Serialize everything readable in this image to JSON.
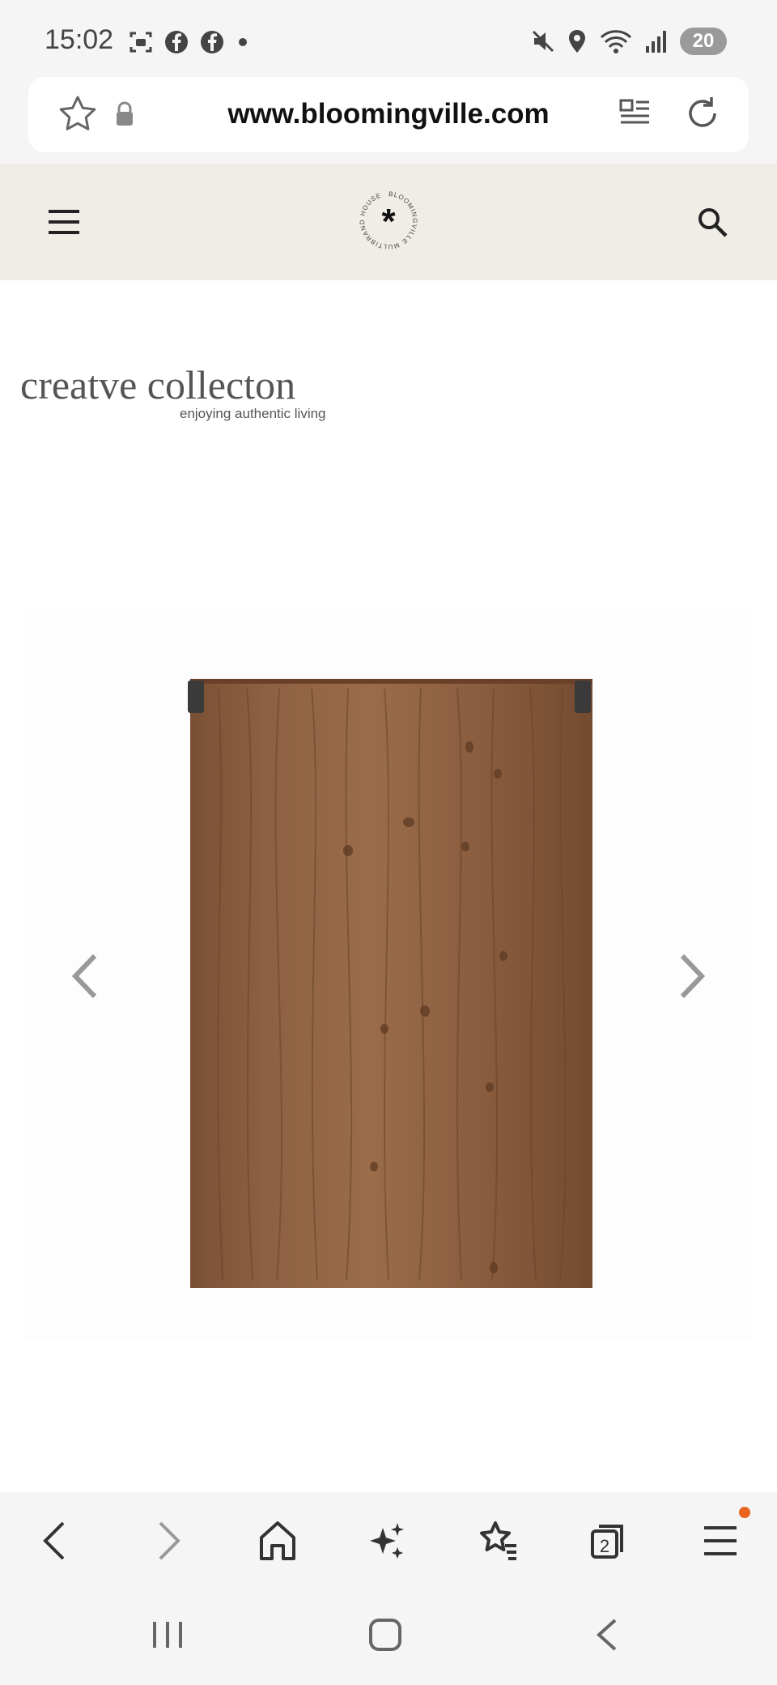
{
  "status_bar": {
    "time": "15:02",
    "battery": "20",
    "icons_left": [
      "screenshot-icon",
      "facebook-icon",
      "facebook-icon",
      "dot-icon"
    ],
    "icons_right": [
      "mute-icon",
      "location-icon",
      "wifi-icon",
      "signal-icon",
      "battery-icon"
    ]
  },
  "browser": {
    "url": "www.bloomingville.com",
    "icons": [
      "star-icon",
      "lock-icon",
      "reader-icon",
      "reload-icon"
    ]
  },
  "site_header": {
    "logo_ring_text": "BLOOMINGVILLE MULTIBRAND HOUSE",
    "logo_symbol": "*",
    "icons": [
      "menu-icon",
      "search-icon"
    ]
  },
  "brand": {
    "title": "creatve collecton",
    "tagline": "enjoying authentic living"
  },
  "carousel": {
    "product_image": "wooden-board-back",
    "prev_icon": "chevron-left-icon",
    "next_icon": "chevron-right-icon"
  },
  "bottom_toolbar": {
    "tabs_count": "2",
    "items": [
      "back-icon",
      "forward-icon",
      "home-icon",
      "sparkle-icon",
      "bookmarks-icon",
      "tabs-icon",
      "menu-icon"
    ],
    "accent_color": "#e8641f"
  },
  "system_nav": {
    "items": [
      "recents-icon",
      "home-icon",
      "back-icon"
    ]
  }
}
